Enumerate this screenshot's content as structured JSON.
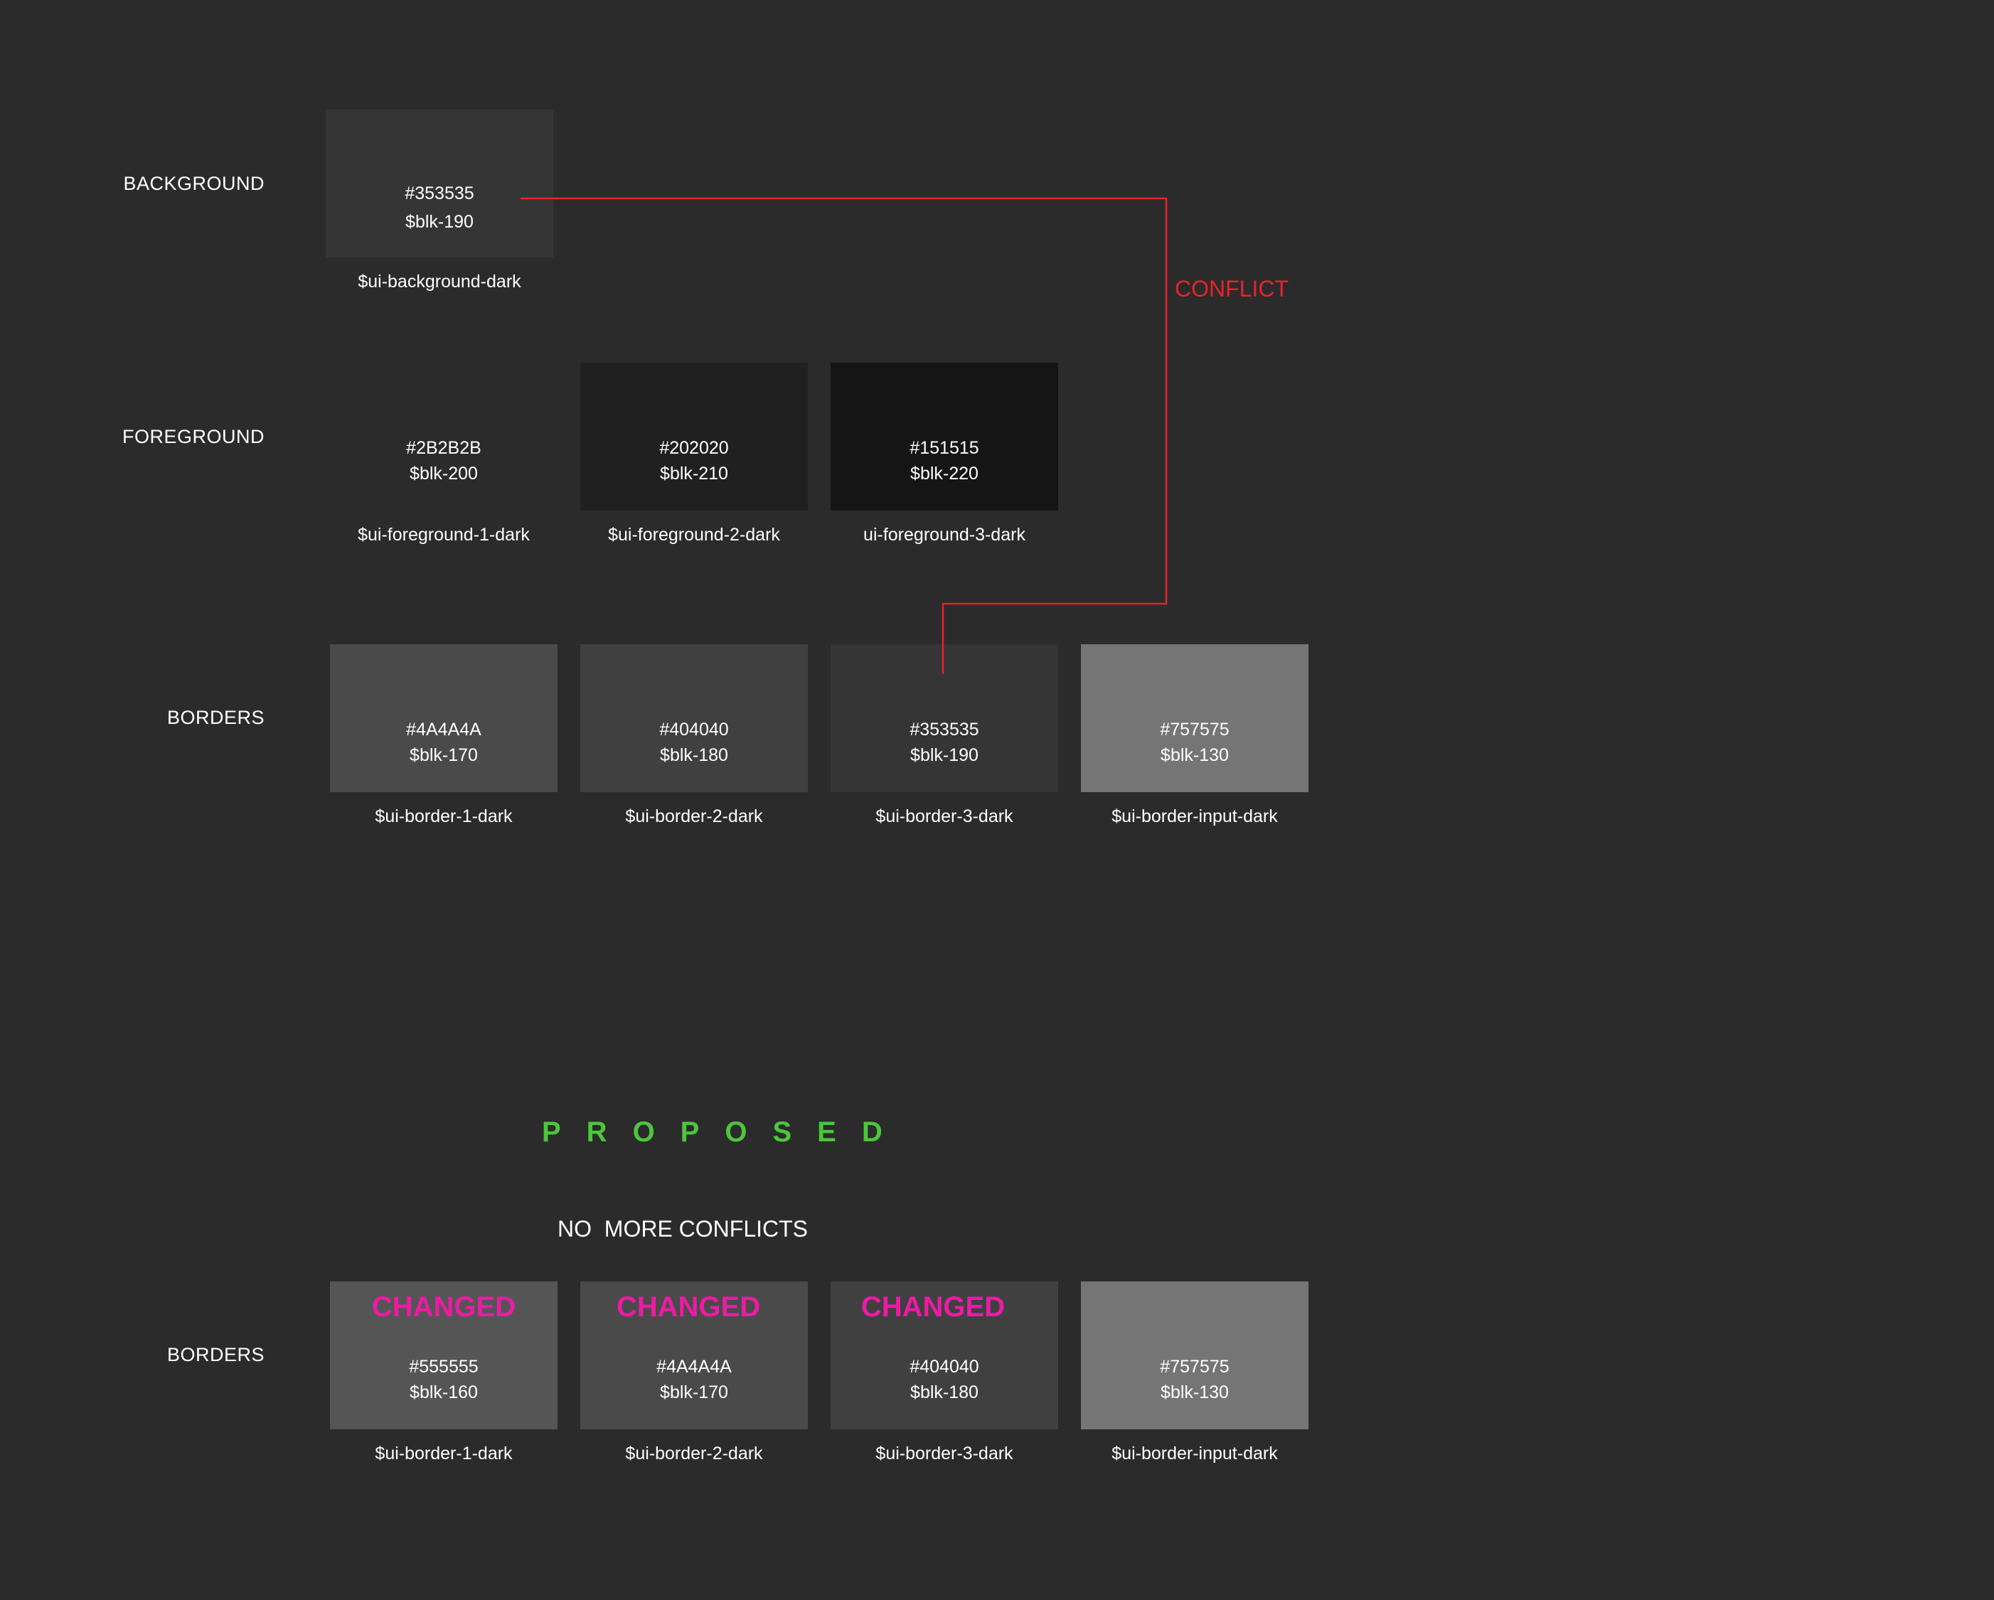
{
  "current": {
    "background": {
      "label": "BACKGROUND",
      "swatches": [
        {
          "hex": "#353535",
          "var": "$blk-190",
          "token": "$ui-background-dark",
          "color": "#353535"
        }
      ]
    },
    "foreground": {
      "label": "FOREGROUND",
      "swatches": [
        {
          "hex": "#2B2B2B",
          "var": "$blk-200",
          "token": "$ui-foreground-1-dark",
          "color": "#2b2b2b"
        },
        {
          "hex": "#202020",
          "var": "$blk-210",
          "token": "$ui-foreground-2-dark",
          "color": "#202020"
        },
        {
          "hex": "#151515",
          "var": "$blk-220",
          "token": "ui-foreground-3-dark",
          "color": "#151515"
        }
      ]
    },
    "borders": {
      "label": "BORDERS",
      "swatches": [
        {
          "hex": "#4A4A4A",
          "var": "$blk-170",
          "token": "$ui-border-1-dark",
          "color": "#4a4a4a"
        },
        {
          "hex": "#404040",
          "var": "$blk-180",
          "token": "$ui-border-2-dark",
          "color": "#404040"
        },
        {
          "hex": "#353535",
          "var": "$blk-190",
          "token": "$ui-border-3-dark",
          "color": "#353535"
        },
        {
          "hex": "#757575",
          "var": "$blk-130",
          "token": "$ui-border-input-dark",
          "color": "#757575"
        }
      ]
    }
  },
  "conflict": {
    "label": "CONFLICT",
    "color": "#e8232b"
  },
  "proposed": {
    "title": "PROPOSED",
    "title_color": "#4bc73a",
    "subtitle": "NO  MORE CONFLICTS",
    "changed_label": "CHANGED",
    "changed_color": "#ec1ba3",
    "borders": {
      "label": "BORDERS",
      "swatches": [
        {
          "hex": "#555555",
          "var": "$blk-160",
          "token": "$ui-border-1-dark",
          "color": "#555555",
          "changed": true
        },
        {
          "hex": "#4A4A4A",
          "var": "$blk-170",
          "token": "$ui-border-2-dark",
          "color": "#4a4a4a",
          "changed": true
        },
        {
          "hex": "#404040",
          "var": "$blk-180",
          "token": "$ui-border-3-dark",
          "color": "#404040",
          "changed": true
        },
        {
          "hex": "#757575",
          "var": "$blk-130",
          "token": "$ui-border-input-dark",
          "color": "#757575",
          "changed": false
        }
      ]
    }
  }
}
